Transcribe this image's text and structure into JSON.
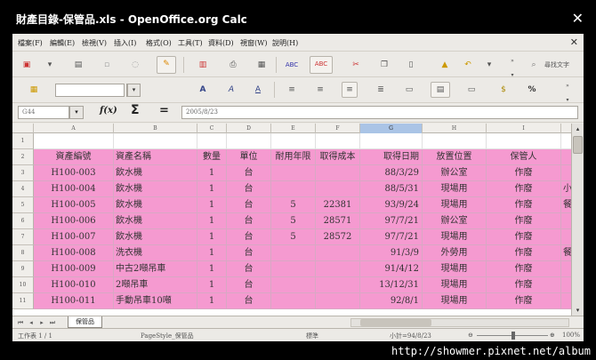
{
  "window": {
    "title": "財產目錄-保管品.xls - OpenOffice.org Calc",
    "close_icon": "✕"
  },
  "menu": [
    {
      "name": "menu-file",
      "label": "檔案(F)"
    },
    {
      "name": "menu-edit",
      "label": "編輯(E)"
    },
    {
      "name": "menu-view",
      "label": "檢視(V)"
    },
    {
      "name": "menu-insert",
      "label": "插入(I)"
    },
    {
      "name": "menu-format",
      "label": "格式(O)"
    },
    {
      "name": "menu-tools",
      "label": "工具(T)"
    },
    {
      "name": "menu-data",
      "label": "資料(D)"
    },
    {
      "name": "menu-window",
      "label": "視窗(W)"
    },
    {
      "name": "menu-help",
      "label": "說明(H)"
    }
  ],
  "toolbar": {
    "find_label": "尋找文字"
  },
  "formula_bar": {
    "cell_ref": "G44",
    "fx": "f(x)",
    "sum": "Σ",
    "equals": "=",
    "content": "2005/8/23"
  },
  "columns": [
    {
      "id": "A",
      "w": 90
    },
    {
      "id": "B",
      "w": 94
    },
    {
      "id": "C",
      "w": 33
    },
    {
      "id": "D",
      "w": 50
    },
    {
      "id": "E",
      "w": 50
    },
    {
      "id": "F",
      "w": 50
    },
    {
      "id": "G",
      "w": 70
    },
    {
      "id": "H",
      "w": 72
    },
    {
      "id": "I",
      "w": 84
    },
    {
      "id": "J",
      "w": 30
    }
  ],
  "selected_column": "G",
  "rows": [
    {
      "num": "1",
      "style": "white",
      "cells": [
        "",
        "",
        "",
        "",
        "",
        "",
        "",
        "",
        "",
        ""
      ]
    },
    {
      "num": "2",
      "style": "pink",
      "cells": [
        "資產編號",
        "資產名稱",
        "數量",
        "單位",
        "耐用年限",
        "取得成本",
        "取得日期",
        "放置位置",
        "保管人",
        ""
      ]
    },
    {
      "num": "3",
      "style": "pink",
      "cells": [
        "H100-003",
        "飲水機",
        "1",
        "台",
        "",
        "",
        "88/3/29",
        "辦公室",
        "作廢",
        ""
      ]
    },
    {
      "num": "4",
      "style": "pink",
      "cells": [
        "H100-004",
        "飲水機",
        "1",
        "台",
        "",
        "",
        "88/5/31",
        "現場用",
        "作廢",
        "小攜"
      ]
    },
    {
      "num": "5",
      "style": "pink",
      "cells": [
        "H100-005",
        "飲水機",
        "1",
        "台",
        "5",
        "22381",
        "93/9/24",
        "現場用",
        "作廢",
        "餐廳"
      ]
    },
    {
      "num": "6",
      "style": "pink",
      "cells": [
        "H100-006",
        "飲水機",
        "1",
        "台",
        "5",
        "28571",
        "97/7/21",
        "辦公室",
        "作廢",
        ""
      ]
    },
    {
      "num": "7",
      "style": "pink",
      "cells": [
        "H100-007",
        "飲水機",
        "1",
        "台",
        "5",
        "28572",
        "97/7/21",
        "現場用",
        "作廢",
        ""
      ]
    },
    {
      "num": "8",
      "style": "pink",
      "cells": [
        "H100-008",
        "洗衣機",
        "1",
        "台",
        "",
        "",
        "91/3/9",
        "外勞用",
        "作廢",
        "餐廳"
      ]
    },
    {
      "num": "9",
      "style": "pink",
      "cells": [
        "H100-009",
        "中古2噸吊車",
        "1",
        "台",
        "",
        "",
        "91/4/12",
        "現場用",
        "作廢",
        ""
      ]
    },
    {
      "num": "10",
      "style": "pink",
      "cells": [
        "H100-010",
        "2噸吊車",
        "1",
        "台",
        "",
        "",
        "13/12/31",
        "現場用",
        "作廢",
        ""
      ]
    },
    {
      "num": "11",
      "style": "pink",
      "cells": [
        "H100-011",
        "手動吊車10噸",
        "1",
        "台",
        "",
        "",
        "92/8/1",
        "現場用",
        "作廢",
        ""
      ]
    }
  ],
  "sheet_tab": "保管品",
  "status": {
    "sheet": "工作表 1 / 1",
    "page_style": "PageStyle_保管品",
    "mode": "標準",
    "sum": "小計=94/8/23",
    "zoom": "100%"
  },
  "watermark": "http://showmer.pixnet.net/album"
}
